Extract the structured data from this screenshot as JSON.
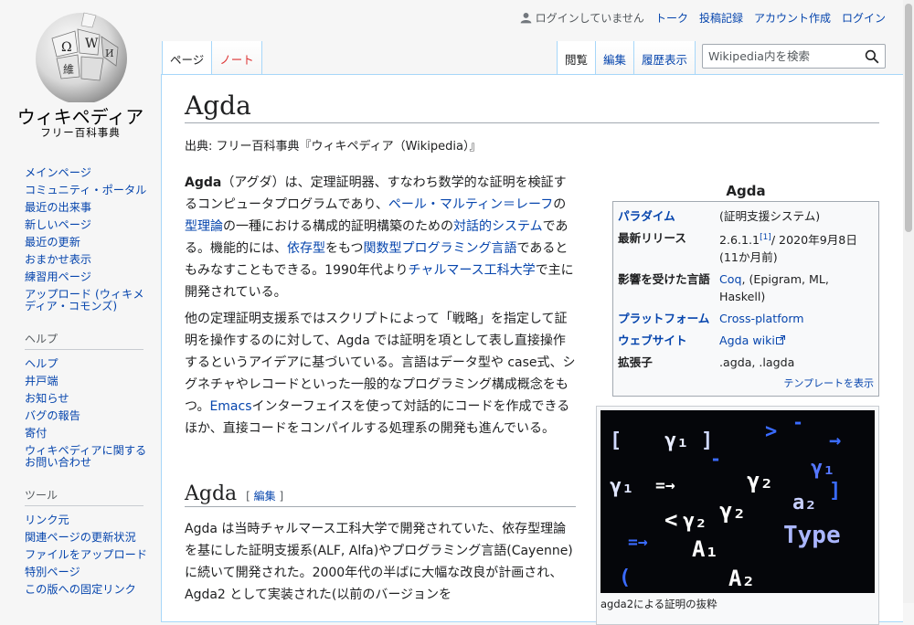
{
  "logo": {
    "wordmark": "ウィキペディア",
    "tagline": "フリー百科事典"
  },
  "personal": {
    "not_logged_in": "ログインしていません",
    "talk": "トーク",
    "contributions": "投稿記録",
    "create_account": "アカウント作成",
    "login": "ログイン"
  },
  "tabs": {
    "page": "ページ",
    "talk": "ノート",
    "read": "閲覧",
    "edit": "編集",
    "history": "履歴表示"
  },
  "search": {
    "placeholder": "Wikipedia内を検索"
  },
  "sidebar": {
    "nav": [
      "メインページ",
      "コミュニティ・ポータル",
      "最近の出来事",
      "新しいページ",
      "最近の更新",
      "おまかせ表示",
      "練習用ページ",
      "アップロード (ウィキメディア・コモンズ)"
    ],
    "help_title": "ヘルプ",
    "help": [
      "ヘルプ",
      "井戸端",
      "お知らせ",
      "バグの報告",
      "寄付",
      "ウィキペディアに関するお問い合わせ"
    ],
    "tools_title": "ツール",
    "tools": [
      "リンク元",
      "関連ページの更新状況",
      "ファイルをアップロード",
      "特別ページ",
      "この版への固定リンク"
    ]
  },
  "article": {
    "title": "Agda",
    "site_sub": "出典: フリー百科事典『ウィキペディア（Wikipedia）』",
    "p1": {
      "b": "Agda",
      "t1": "（アグダ）は、定理証明器、すなわち数学的な証明を検証するコンピュータプログラムであり、",
      "l1": "ペール・マルティン＝レーフ",
      "t2": "の",
      "l2": "型理論",
      "t3": "の一種における構成的証明構築のための",
      "l3": "対話的システム",
      "t4": "である。機能的には、",
      "l4": "依存型",
      "t5": "をもつ",
      "l5": "関数型プログラミング言語",
      "t6": "であるともみなすこともできる。1990年代より",
      "l6": "チャルマース工科大学",
      "t7": "で主に開発されている。"
    },
    "p2": {
      "t1": "他の定理証明支援系ではスクリプトによって「戦略」を指定して証明を操作するのに対して、Agda では証明を項として表し直接操作するというアイデアに基づいている。言語はデータ型や case式、シグネチャやレコードといった一般的なプログラミング構成概念をもつ。",
      "l1": "Emacs",
      "t2": "インターフェイスを使って対話的にコードを作成できるほか、直接コードをコンパイルする処理系の開発も進んでいる。"
    },
    "h2": "Agda",
    "h2_edit_open": "[ ",
    "h2_edit": "編集",
    "h2_edit_close": " ]",
    "p3": "Agda は当時チャルマース工科大学で開発されていた、依存型理論を基にした証明支援系(ALF, Alfa)やプログラミング言語(Cayenne)に続いて開発された。2000年代の半ばに大幅な改良が計画され、 Agda2 として実装された(以前のバージョンを"
  },
  "infobox": {
    "title": "Agda",
    "paradigm_k": "パラダイム",
    "paradigm_v": "(証明支援システム)",
    "release_k": "最新リリース",
    "release_v1": "2.6.1.1",
    "release_ref": "[1]",
    "release_v2": "/ 2020年9月8日 (11か月前)",
    "influenced_k": "影響を受けた言語",
    "influenced_l": "Coq",
    "influenced_v": ", (Epigram, ML, Haskell)",
    "platform_k": "プラットフォーム",
    "platform_v": "Cross-platform",
    "website_k": "ウェブサイト",
    "website_v": "Agda wiki",
    "ext_k": "拡張子",
    "ext_v": ".agda, .lagda",
    "footer": "テンプレートを表示"
  },
  "thumb": {
    "caption": "agda2による証明の抜粋",
    "glyphs": [
      "[",
      "γ₁",
      "]",
      "-",
      "γ₂",
      "γ₁",
      "=→",
      "γ₂",
      "]",
      "a₂",
      "<",
      "γ₂",
      "Type",
      "A₁",
      "=→",
      "A₂",
      "(",
      "→",
      "γ₁",
      "-",
      ">"
    ]
  },
  "colors": {
    "link": "#0645ad",
    "new_link": "#d33",
    "border": "#a7d7f9"
  }
}
